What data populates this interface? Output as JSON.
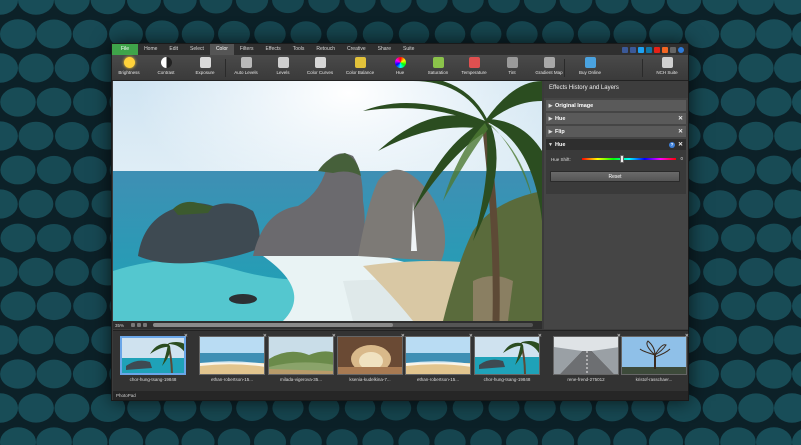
{
  "menu": {
    "tabs": [
      "File",
      "Home",
      "Edit",
      "Select",
      "Color",
      "Filters",
      "Effects",
      "Tools",
      "Retouch",
      "Creative",
      "Share",
      "Suite"
    ],
    "active_tab": "Color"
  },
  "ribbon": {
    "buttons": [
      {
        "label": "Brightness",
        "icon": "sun-icon"
      },
      {
        "label": "Contrast",
        "icon": "contrast-icon"
      },
      {
        "label": "Exposure",
        "icon": "exposure-icon"
      },
      {
        "label": "Auto Levels",
        "icon": "auto-levels-icon"
      },
      {
        "label": "Levels",
        "icon": "levels-icon"
      },
      {
        "label": "Color Curves",
        "icon": "curves-icon"
      },
      {
        "label": "Color Balance",
        "icon": "balance-icon"
      },
      {
        "label": "Hue",
        "icon": "hue-wheel-icon"
      },
      {
        "label": "Saturation",
        "icon": "saturation-icon"
      },
      {
        "label": "Temperature",
        "icon": "thermometer-icon"
      },
      {
        "label": "Tint",
        "icon": "tint-icon"
      },
      {
        "label": "Gradient Map",
        "icon": "gradient-map-icon"
      },
      {
        "label": "Buy Online",
        "icon": "cart-icon"
      },
      {
        "label": "NCH Suite",
        "icon": "suite-icon"
      }
    ]
  },
  "canvas": {
    "zoom": "35%"
  },
  "effects_panel": {
    "title": "Effects History and Layers",
    "items": [
      {
        "label": "Original Image",
        "closable": false,
        "expanded": false
      },
      {
        "label": "Hue",
        "closable": true,
        "expanded": false
      },
      {
        "label": "Flip",
        "closable": true,
        "expanded": false
      },
      {
        "label": "Hue",
        "closable": true,
        "expanded": true
      }
    ],
    "hue_shift_label": "Hue Shift:",
    "hue_shift_value": "0",
    "hue_shift_fraction": 0.43,
    "reset_label": "Reset"
  },
  "filmstrip": {
    "items": [
      {
        "caption": "chor-hung-tsang-19848",
        "scene": "palm",
        "selected": true
      },
      {
        "caption": "ethan-robertson-15...",
        "scene": "beach",
        "selected": false
      },
      {
        "caption": "milada-vigerova-35...",
        "scene": "hills",
        "selected": false
      },
      {
        "caption": "ksenia-kudelkina-7...",
        "scene": "cave",
        "selected": false
      },
      {
        "caption": "ethan-robertson-15...",
        "scene": "beach",
        "selected": false
      },
      {
        "caption": "chor-hung-tsang-19848",
        "scene": "palm",
        "selected": false
      },
      {
        "caption": "rene-frend-275012",
        "scene": "road",
        "selected": false
      },
      {
        "caption": "kristof-rasschaer...",
        "scene": "tree",
        "selected": false
      }
    ]
  },
  "status": {
    "app_name": "PhotoPad"
  },
  "colors": {
    "file_tab": "#3fa44a",
    "accent": "#6aa6e8",
    "panel": "#454545",
    "background": "#0c2128"
  }
}
